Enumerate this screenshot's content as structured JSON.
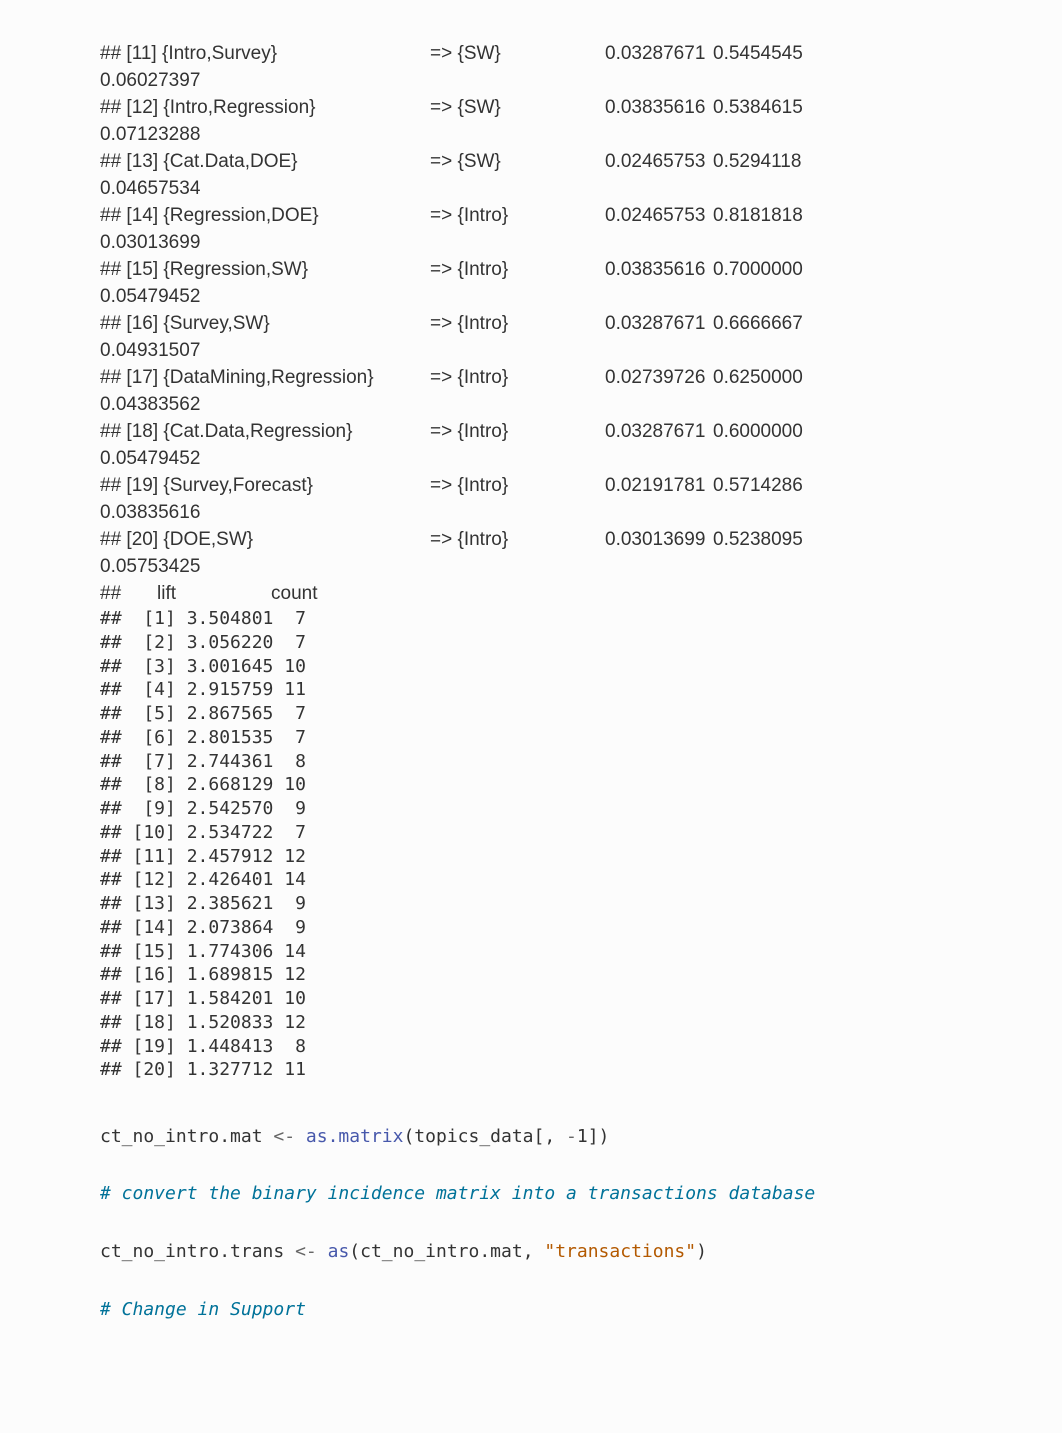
{
  "rules": [
    {
      "idx": "[11]",
      "lhs": "{Intro,Survey}",
      "rhs": "{SW}",
      "support": "0.03287671",
      "confidence": "0.5454545",
      "coverage": "0.06027397"
    },
    {
      "idx": "[12]",
      "lhs": "{Intro,Regression}",
      "rhs": "{SW}",
      "support": "0.03835616",
      "confidence": "0.5384615",
      "coverage": "0.07123288"
    },
    {
      "idx": "[13]",
      "lhs": "{Cat.Data,DOE}",
      "rhs": "{SW}",
      "support": "0.02465753",
      "confidence": "0.5294118",
      "coverage": "0.04657534"
    },
    {
      "idx": "[14]",
      "lhs": "{Regression,DOE}",
      "rhs": "{Intro}",
      "support": "0.02465753",
      "confidence": "0.8181818",
      "coverage": "0.03013699"
    },
    {
      "idx": "[15]",
      "lhs": "{Regression,SW}",
      "rhs": "{Intro}",
      "support": "0.03835616",
      "confidence": "0.7000000",
      "coverage": "0.05479452"
    },
    {
      "idx": "[16]",
      "lhs": "{Survey,SW}",
      "rhs": "{Intro}",
      "support": "0.03287671",
      "confidence": "0.6666667",
      "coverage": "0.04931507"
    },
    {
      "idx": "[17]",
      "lhs": "{DataMining,Regression}",
      "rhs": "{Intro}",
      "support": "0.02739726",
      "confidence": "0.6250000",
      "coverage": "0.04383562"
    },
    {
      "idx": "[18]",
      "lhs": "{Cat.Data,Regression}",
      "rhs": "{Intro}",
      "support": "0.03287671",
      "confidence": "0.6000000",
      "coverage": "0.05479452"
    },
    {
      "idx": "[19]",
      "lhs": "{Survey,Forecast}",
      "rhs": "{Intro}",
      "support": "0.02191781",
      "confidence": "0.5714286",
      "coverage": "0.03835616"
    },
    {
      "idx": "[20]",
      "lhs": "{DOE,SW}",
      "rhs": "{Intro}",
      "support": "0.03013699",
      "confidence": "0.5238095",
      "coverage": "0.05753425"
    }
  ],
  "lift_header": {
    "hash": "##",
    "lift": "lift",
    "count": "count"
  },
  "lift_table": [
    {
      "idx": "[1]",
      "lift": "3.504801",
      "count": " 7"
    },
    {
      "idx": "[2]",
      "lift": "3.056220",
      "count": " 7"
    },
    {
      "idx": "[3]",
      "lift": "3.001645",
      "count": "10"
    },
    {
      "idx": "[4]",
      "lift": "2.915759",
      "count": "11"
    },
    {
      "idx": "[5]",
      "lift": "2.867565",
      "count": " 7"
    },
    {
      "idx": "[6]",
      "lift": "2.801535",
      "count": " 7"
    },
    {
      "idx": "[7]",
      "lift": "2.744361",
      "count": " 8"
    },
    {
      "idx": "[8]",
      "lift": "2.668129",
      "count": "10"
    },
    {
      "idx": "[9]",
      "lift": "2.542570",
      "count": " 9"
    },
    {
      "idx": "[10]",
      "lift": "2.534722",
      "count": " 7"
    },
    {
      "idx": "[11]",
      "lift": "2.457912",
      "count": "12"
    },
    {
      "idx": "[12]",
      "lift": "2.426401",
      "count": "14"
    },
    {
      "idx": "[13]",
      "lift": "2.385621",
      "count": " 9"
    },
    {
      "idx": "[14]",
      "lift": "2.073864",
      "count": " 9"
    },
    {
      "idx": "[15]",
      "lift": "1.774306",
      "count": "14"
    },
    {
      "idx": "[16]",
      "lift": "1.689815",
      "count": "12"
    },
    {
      "idx": "[17]",
      "lift": "1.584201",
      "count": "10"
    },
    {
      "idx": "[18]",
      "lift": "1.520833",
      "count": "12"
    },
    {
      "idx": "[19]",
      "lift": "1.448413",
      "count": " 8"
    },
    {
      "idx": "[20]",
      "lift": "1.327712",
      "count": "11"
    }
  ],
  "code": {
    "line1": {
      "p1": "ct_no_intro.mat ",
      "op1": "<-",
      "p2": " ",
      "fn": "as.matrix",
      "p3": "(topics_data[, ",
      "op2": "-",
      "num": "1",
      "p4": "])"
    },
    "comment1": "# convert the binary incidence matrix into a transactions database",
    "line2": {
      "p1": "ct_no_intro.trans ",
      "op1": "<-",
      "p2": " ",
      "fn": "as",
      "p3": "(ct_no_intro.mat, ",
      "str": "\"transactions\"",
      "p4": ")"
    },
    "comment2": "# Change in Support"
  }
}
